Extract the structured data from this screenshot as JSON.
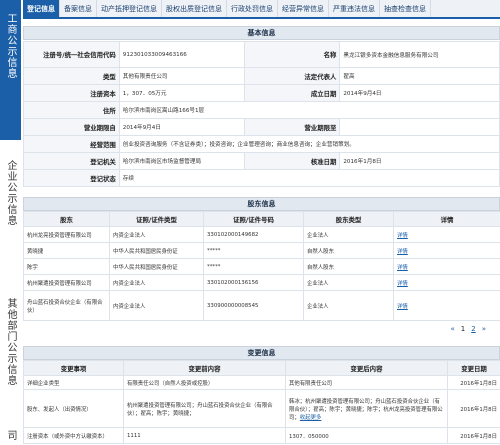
{
  "sidebar": {
    "tabs": [
      {
        "label": "工商公示信息"
      },
      {
        "label": "企业公示信息"
      },
      {
        "label": "其他部门公示信息"
      },
      {
        "label": "司"
      }
    ]
  },
  "tabs": [
    {
      "label": "登记信息"
    },
    {
      "label": "备案信息"
    },
    {
      "label": "动产抵押登记信息"
    },
    {
      "label": "股权出质登记信息"
    },
    {
      "label": "行政处罚信息"
    },
    {
      "label": "经营异常信息"
    },
    {
      "label": "严重违法信息"
    },
    {
      "label": "抽查检查信息"
    }
  ],
  "basic": {
    "title": "基本信息",
    "reg_no_label": "注册号/统一社会信用代码",
    "reg_no": "912301033009463166",
    "name_label": "名称",
    "name": "黑龙江银多资本金融信息服务有限公司",
    "type_label": "类型",
    "type": "其他有限责任公司",
    "legal_label": "法定代表人",
    "legal": "翟高",
    "capital_label": "注册资本",
    "capital": "1，307．05万元",
    "found_label": "成立日期",
    "found": "2014年9月4日",
    "address_label": "住所",
    "address": "哈尔滨市南岗区嵩山路166号1层",
    "period_from_label": "营业期限自",
    "period_from": "2014年9月4日",
    "period_to_label": "营业期限至",
    "period_to": "",
    "scope_label": "经营范围",
    "scope": "创业投资咨询服务（不含证券类）；投资咨询；企业管理咨询；商业信息咨询；企业营销策划。",
    "authority_label": "登记机关",
    "authority": "哈尔滨市南岗区市场监督管理局",
    "approve_label": "核准日期",
    "approve": "2016年1月8日",
    "status_label": "登记状态",
    "status": "存续"
  },
  "shareholders": {
    "title": "股东信息",
    "headers": [
      "股东",
      "证照/证件类型",
      "证照/证件号码",
      "股东类型",
      "详情"
    ],
    "rows": [
      {
        "name": "杭州龙亮投资管理有限公司",
        "id_type": "内资企业法人",
        "id_no": "330102000149682",
        "kind": "企业法人",
        "detail": "详情"
      },
      {
        "name": "黄晓捷",
        "id_type": "中华人民共和国居民身份证",
        "id_no": "*****",
        "kind": "自然人股东",
        "detail": "详情"
      },
      {
        "name": "陈宇",
        "id_type": "中华人民共和国居民身份证",
        "id_no": "*****",
        "kind": "自然人股东",
        "detail": "详情"
      },
      {
        "name": "杭州聚遭投资管理有限公司",
        "id_type": "内资企业法人",
        "id_no": "330102000136156",
        "kind": "企业法人",
        "detail": "详情"
      },
      {
        "name": "舟山蓝石投资合伙企业（有限合伙）",
        "id_type": "内资企业法人",
        "id_no": "330900000008545",
        "kind": "企业法人",
        "detail": "详情"
      }
    ],
    "pager": {
      "prev": "«",
      "page1": "1",
      "page2": "2",
      "next": "»"
    }
  },
  "changes": {
    "title": "变更信息",
    "headers": [
      "变更事项",
      "变更前内容",
      "变更后内容",
      "变更日期"
    ],
    "rows": [
      {
        "item": "详细企业类型",
        "before": "有限责任公司（自然人投资或控股）",
        "after": "其他有限责任公司",
        "date": "2016年1月8日"
      },
      {
        "item": "股东、发起人（出资情况）",
        "before": "杭州聚遭投资管理有限公司；舟山蓝石投资合伙企业（有限合伙）；翟高；陈宇；黄晓捷；",
        "after": "韩冰；杭州聚遭投资管理有限公司；舟山蓝石投资合伙企业（有限合伙）；翟高；陈宇；黄晓捷；陈宇；杭州龙亮投资管理有限公司；",
        "after_more": "收起更多",
        "date": "2016年1月8日"
      },
      {
        "item": "注册资本（或外资中方认缴资本）",
        "before": "1111",
        "after": "1307．050000",
        "date": "2016年1月8日"
      }
    ]
  },
  "colors": {
    "accent": "#1a5fa8",
    "header_bg": "#e2e8ef"
  }
}
